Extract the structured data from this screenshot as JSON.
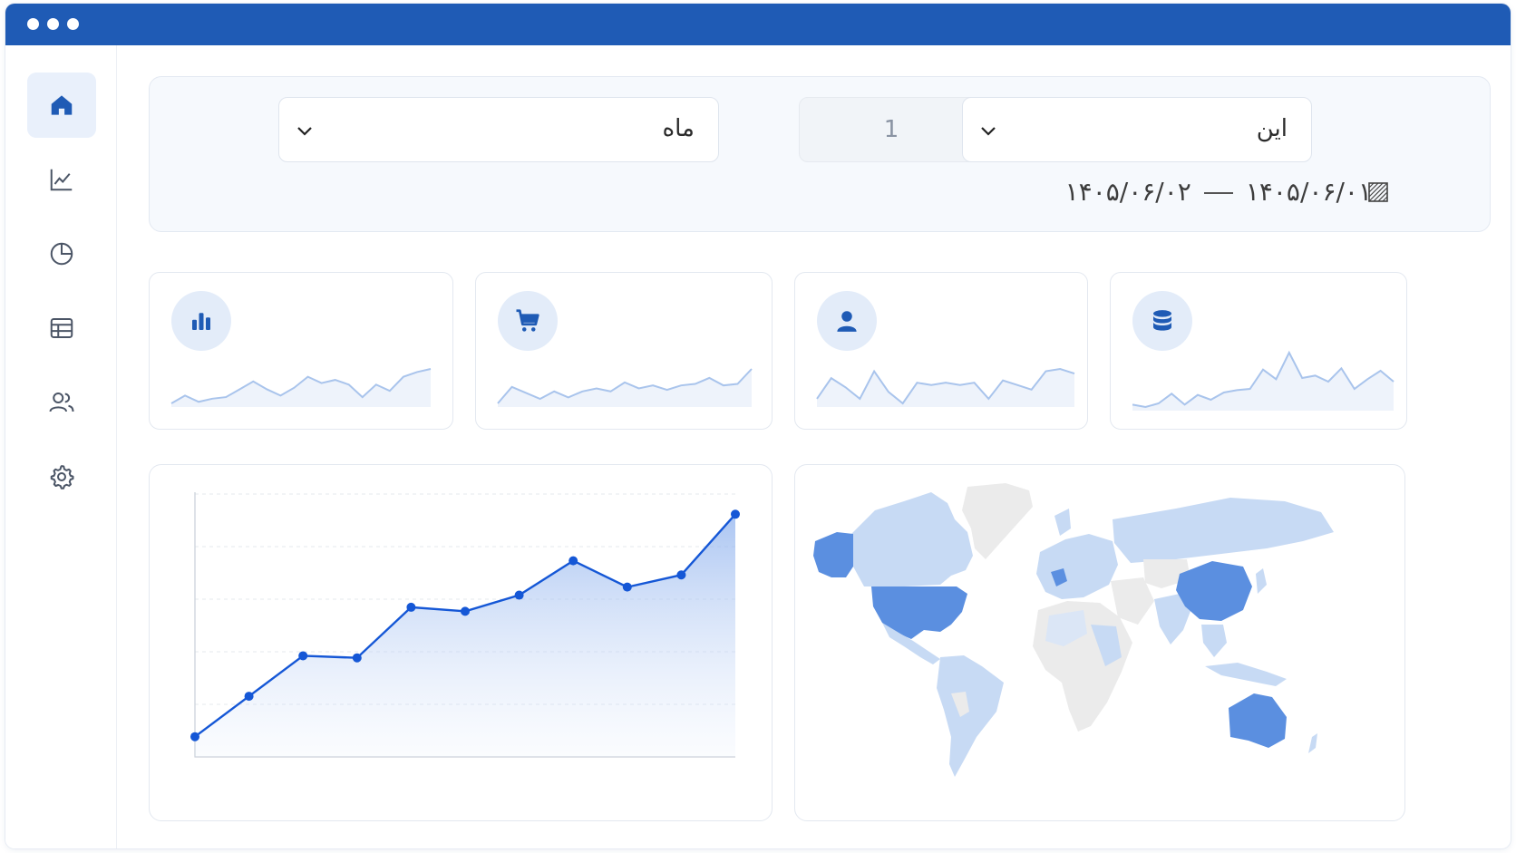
{
  "colors": {
    "accent": "#1f5bb5",
    "line": "#1557d6",
    "sparkline": "#a9c4ec",
    "map_dark": "#5b8fe0",
    "map_light": "#c7daf4",
    "map_grey": "#ebebeb"
  },
  "window": {
    "controls": [
      "dot",
      "dot",
      "dot"
    ]
  },
  "sidebar": {
    "items": [
      {
        "icon": "home-icon",
        "active": true
      },
      {
        "icon": "line-chart-icon",
        "active": false
      },
      {
        "icon": "pie-chart-icon",
        "active": false
      },
      {
        "icon": "table-icon",
        "active": false
      },
      {
        "icon": "users-icon",
        "active": false
      },
      {
        "icon": "settings-icon",
        "active": false
      }
    ]
  },
  "filter": {
    "relative": "این",
    "amount": "1",
    "unit": "ماه",
    "date_from": "۱۴۰۵/۰۶/۰۱",
    "date_to": "۱۴۰۵/۰۶/۰۲",
    "calendar_icon": "calendar-icon"
  },
  "stat_cards": [
    {
      "icon": "bar-chart-icon",
      "spark": [
        8,
        13,
        9,
        11,
        12,
        17,
        22,
        17,
        13,
        18,
        25,
        21,
        23,
        20,
        12,
        20,
        16,
        25,
        28,
        30
      ]
    },
    {
      "icon": "cart-icon",
      "spark": [
        8,
        19,
        15,
        11,
        16,
        12,
        16,
        18,
        16,
        22,
        18,
        20,
        17,
        20,
        21,
        25,
        20,
        21,
        31
      ]
    },
    {
      "icon": "user-icon",
      "spark": [
        10,
        19,
        15,
        10,
        22,
        13,
        8,
        17,
        16,
        17,
        16,
        17,
        10,
        18,
        16,
        14,
        22,
        23,
        21
      ]
    },
    {
      "icon": "database-icon",
      "spark": [
        5,
        3,
        6,
        14,
        5,
        13,
        9,
        15,
        17,
        18,
        34,
        26,
        48,
        27,
        29,
        24,
        35,
        18,
        26,
        33,
        24
      ]
    }
  ],
  "chart_data": {
    "type": "area",
    "x": [
      1,
      2,
      3,
      4,
      5,
      6,
      7,
      8,
      9,
      10,
      11
    ],
    "values": [
      10,
      30,
      50,
      49,
      74,
      72,
      80,
      97,
      84,
      90,
      120
    ],
    "ylim": [
      0,
      130
    ],
    "grid": true,
    "title": "",
    "xlabel": "",
    "ylabel": ""
  },
  "map": {
    "icon": "world-map",
    "highlighted": [
      "Alaska",
      "United States",
      "China",
      "Australia"
    ],
    "light": [
      "Canada",
      "South America",
      "Europe",
      "Russia",
      "Asia",
      "North Africa"
    ]
  }
}
